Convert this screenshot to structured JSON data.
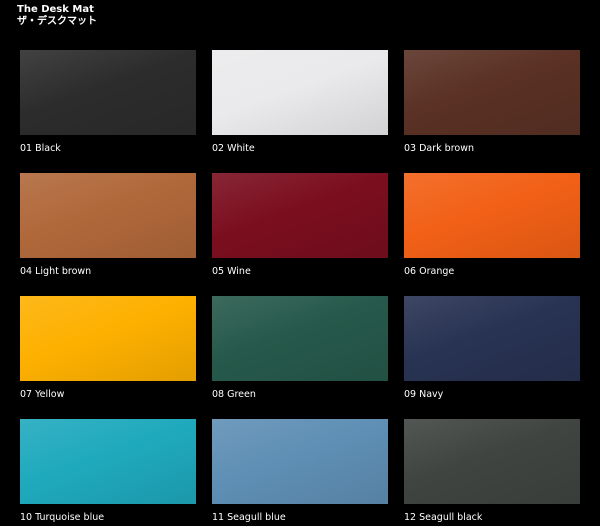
{
  "header": {
    "title": "The Desk Mat",
    "subtitle": "ザ・デスクマット"
  },
  "colors": [
    {
      "label": "01 Black",
      "color": "#2c2c2c"
    },
    {
      "label": "02 White",
      "color": "#eaeaec"
    },
    {
      "label": "03 Dark brown",
      "color": "#5a3124"
    },
    {
      "label": "04 Light brown",
      "color": "#b0683a"
    },
    {
      "label": "05 Wine",
      "color": "#7a0e1f"
    },
    {
      "label": "06 Orange",
      "color": "#f26016"
    },
    {
      "label": "07 Yellow",
      "color": "#fdb000"
    },
    {
      "label": "08 Green",
      "color": "#26594b"
    },
    {
      "label": "09 Navy",
      "color": "#283252"
    },
    {
      "label": "10 Turquoise blue",
      "color": "#1fa9bd"
    },
    {
      "label": "11 Seagull blue",
      "color": "#5f8fb5"
    },
    {
      "label": "12 Seagull black",
      "color": "#3f4441"
    }
  ]
}
